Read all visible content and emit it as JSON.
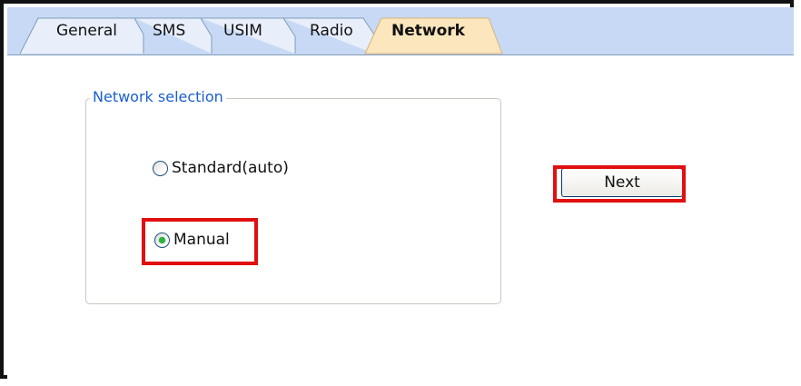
{
  "tabs": [
    {
      "label": "General",
      "active": false
    },
    {
      "label": "SMS",
      "active": false
    },
    {
      "label": "USIM",
      "active": false
    },
    {
      "label": "Radio",
      "active": false
    },
    {
      "label": "Network",
      "active": true
    }
  ],
  "network_selection": {
    "title": "Network selection",
    "options": [
      {
        "label": "Standard(auto)",
        "selected": false
      },
      {
        "label": "Manual",
        "selected": true
      }
    ]
  },
  "next_button": {
    "label": "Next"
  },
  "colors": {
    "tab_strip": "#c7d9f5",
    "active_tab": "#fce6bd",
    "highlight": "#e01010",
    "group_title": "#1a5fd0"
  }
}
